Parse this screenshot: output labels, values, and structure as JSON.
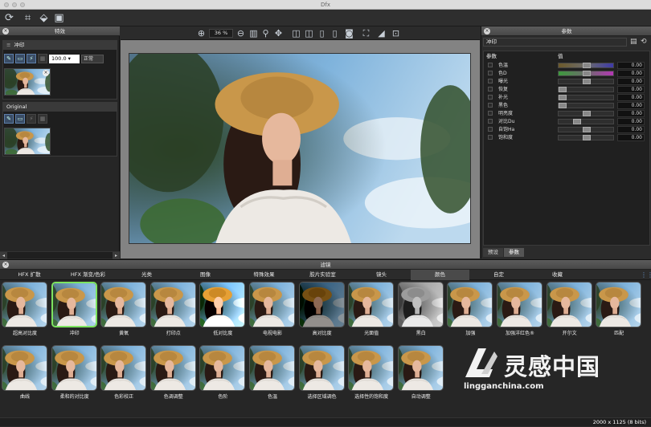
{
  "window": {
    "title": "Dfx"
  },
  "left_panel": {
    "header": "特效",
    "preset_name": "冲印",
    "opacity_value": "100.0",
    "blend_mode": "正常",
    "original_label": "Original"
  },
  "center": {
    "zoom": "36 %"
  },
  "right_panel": {
    "header": "参数",
    "preset_name": "冲印",
    "col_param": "参数",
    "col_value": "值",
    "params": [
      {
        "name": "色温",
        "value": "0.00",
        "pos": 0.5,
        "track": "temp"
      },
      {
        "name": "色D",
        "value": "0.00",
        "pos": 0.5,
        "track": "tint"
      },
      {
        "name": "曝光",
        "value": "0.00",
        "pos": 0.5,
        "track": "plain"
      },
      {
        "name": "恢复",
        "value": "0.00",
        "pos": 0.0,
        "track": "plain"
      },
      {
        "name": "补光",
        "value": "0.00",
        "pos": 0.0,
        "track": "plain"
      },
      {
        "name": "黑色",
        "value": "0.00",
        "pos": 0.0,
        "track": "plain"
      },
      {
        "name": "明亮度",
        "value": "0.00",
        "pos": 0.5,
        "track": "plain"
      },
      {
        "name": "对比Du",
        "value": "0.00",
        "pos": 0.3,
        "track": "plain"
      },
      {
        "name": "自饱Ha",
        "value": "0.00",
        "pos": 0.5,
        "track": "plain"
      },
      {
        "name": "饱和度",
        "value": "0.00",
        "pos": 0.5,
        "track": "plain"
      }
    ],
    "tabs": [
      "预设",
      "参数"
    ]
  },
  "filters": {
    "header": "滤镜",
    "categories": [
      "HFX 扩散",
      "HFX 渐变/色彩",
      "光类",
      "图像",
      "特殊效果",
      "胶片实验室",
      "镜头",
      "颜色",
      "自定",
      "收藏"
    ],
    "active_category": 7,
    "row1": [
      "超高对比度",
      "冲印",
      "黄氧",
      "打印点",
      "低对比度",
      "电视电影",
      "高对比度",
      "光面值",
      "黑白",
      "加强",
      "加强洋红色®",
      "开尔文",
      "匹配"
    ],
    "row2": [
      "曲线",
      "柔和的对比度",
      "色彩校正",
      "色调调整",
      "色阶",
      "色温",
      "选择区域调色",
      "选择性的饱和度",
      "自动调整"
    ],
    "selected": 1
  },
  "status": {
    "resolution": "2000 x 1125 (8 bits)"
  },
  "watermark": {
    "text": "灵感中国",
    "url": "lingganchina.com"
  }
}
